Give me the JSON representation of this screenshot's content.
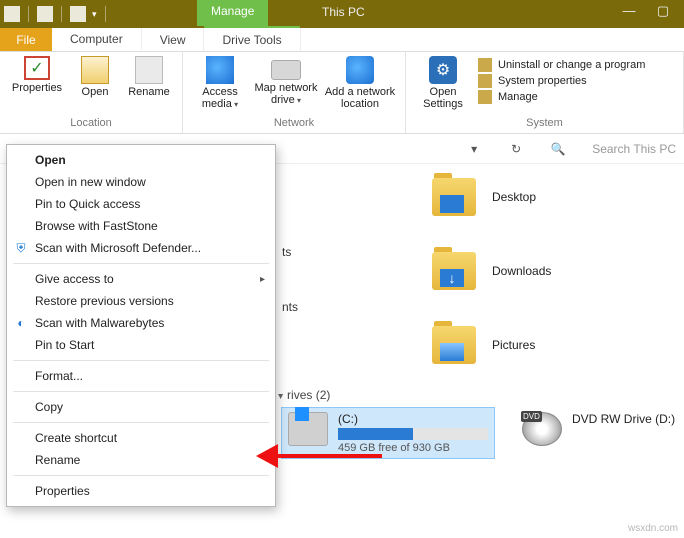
{
  "title": "This PC",
  "manage_tab": "Manage",
  "tabs": {
    "file": "File",
    "computer": "Computer",
    "view": "View",
    "drive_tools": "Drive Tools"
  },
  "ribbon": {
    "location": {
      "label": "Location",
      "properties": "Properties",
      "open": "Open",
      "rename": "Rename"
    },
    "network": {
      "label": "Network",
      "access_media": "Access media",
      "map_network_drive": "Map network drive",
      "add_network_location": "Add a network location"
    },
    "system": {
      "label": "System",
      "open_settings": "Open Settings",
      "uninstall": "Uninstall or change a program",
      "sys_props": "System properties",
      "manage": "Manage"
    }
  },
  "searchbar": {
    "refresh": "↻",
    "placeholder": "Search This PC"
  },
  "folders": {
    "desktop": "Desktop",
    "downloads": "Downloads",
    "pictures": "Pictures",
    "col1a_suffix": "ts",
    "col1b_suffix": "nts"
  },
  "drives": {
    "header": "rives (2)",
    "c": {
      "name": "(C:)",
      "caption": "459 GB free of 930 GB",
      "fill_pct": 50
    },
    "d": {
      "name": "DVD RW Drive (D:)"
    }
  },
  "context_menu": {
    "open": "Open",
    "open_new": "Open in new window",
    "pin_quick": "Pin to Quick access",
    "browse_fs": "Browse with FastStone",
    "scan_def": "Scan with Microsoft Defender...",
    "give_access": "Give access to",
    "restore": "Restore previous versions",
    "scan_mb": "Scan with Malwarebytes",
    "pin_start": "Pin to Start",
    "format": "Format...",
    "copy": "Copy",
    "create_shortcut": "Create shortcut",
    "rename": "Rename",
    "properties": "Properties"
  },
  "watermark": "wsxdn.com"
}
